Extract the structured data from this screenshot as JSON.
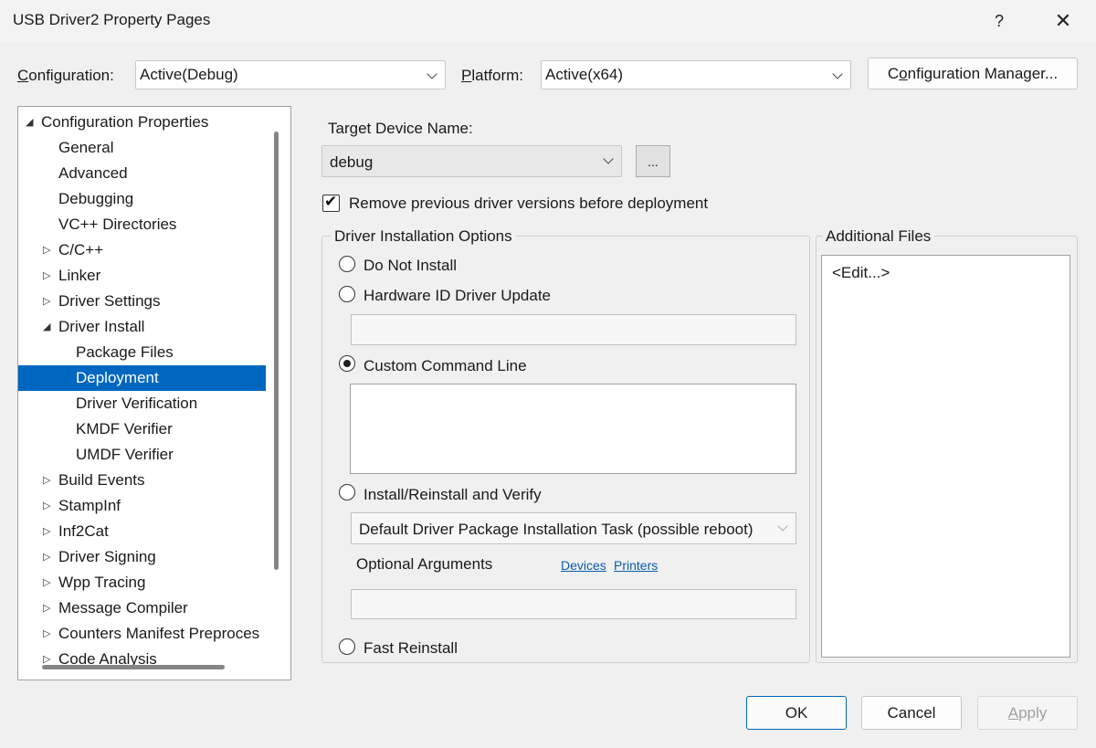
{
  "window": {
    "title": "USB Driver2 Property Pages",
    "help_glyph": "?",
    "close_glyph": "✕"
  },
  "header": {
    "configuration_label": "Configuration:",
    "configuration_value": "Active(Debug)",
    "platform_label": "Platform:",
    "platform_value": "Active(x64)",
    "config_manager_label": "Configuration Manager..."
  },
  "tree": {
    "items": [
      {
        "label": "Configuration Properties",
        "twisty": "◢"
      },
      {
        "label": "General",
        "twisty": ""
      },
      {
        "label": "Advanced",
        "twisty": ""
      },
      {
        "label": "Debugging",
        "twisty": ""
      },
      {
        "label": "VC++ Directories",
        "twisty": ""
      },
      {
        "label": "C/C++",
        "twisty": "▷"
      },
      {
        "label": "Linker",
        "twisty": "▷"
      },
      {
        "label": "Driver Settings",
        "twisty": "▷"
      },
      {
        "label": "Driver Install",
        "twisty": "◢"
      },
      {
        "label": "Package Files",
        "twisty": ""
      },
      {
        "label": "Deployment",
        "twisty": "",
        "selected": true
      },
      {
        "label": "Driver Verification",
        "twisty": ""
      },
      {
        "label": "KMDF Verifier",
        "twisty": ""
      },
      {
        "label": "UMDF Verifier",
        "twisty": ""
      },
      {
        "label": "Build Events",
        "twisty": "▷"
      },
      {
        "label": "StampInf",
        "twisty": "▷"
      },
      {
        "label": "Inf2Cat",
        "twisty": "▷"
      },
      {
        "label": "Driver Signing",
        "twisty": "▷"
      },
      {
        "label": "Wpp Tracing",
        "twisty": "▷"
      },
      {
        "label": "Message Compiler",
        "twisty": "▷"
      },
      {
        "label": "Counters Manifest Preproces",
        "twisty": "▷"
      },
      {
        "label": "Code Analysis",
        "twisty": "▷"
      }
    ]
  },
  "deployment": {
    "target_device_label": "Target Device Name:",
    "target_device_value": "debug",
    "browse_label": "...",
    "remove_previous_label": "Remove previous driver versions before deployment",
    "remove_previous_checked": true,
    "checkmark_glyph": "✔",
    "install_options_title": "Driver Installation Options",
    "opt_do_not_install": "Do Not Install",
    "opt_hardware_id": "Hardware ID Driver Update",
    "hardware_id_value": "",
    "opt_custom_command": "Custom Command Line",
    "custom_command_value": "",
    "opt_install_verify": "Install/Reinstall and Verify",
    "install_task_value": "Default Driver Package Installation Task (possible reboot)",
    "optional_args_label": "Optional Arguments",
    "devices_link": "Devices",
    "printers_link": "Printers",
    "optional_args_value": "",
    "opt_fast_reinstall": "Fast Reinstall",
    "selected_option": "Custom Command Line",
    "additional_files_title": "Additional Files",
    "additional_files_value": "<Edit...>"
  },
  "footer": {
    "ok_label": "OK",
    "cancel_label": "Cancel",
    "apply_label": "Apply"
  }
}
